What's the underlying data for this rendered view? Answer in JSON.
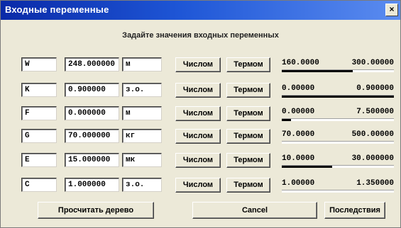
{
  "window": {
    "title": "Входные переменные",
    "close_label": "×"
  },
  "subtitle": "Задайте значения входных переменных",
  "variables": [
    {
      "name": "W",
      "value": "248.000000",
      "unit": "м",
      "num_label": "Числом",
      "term_label": "Термом",
      "min": "160.0000",
      "max": "300.00000",
      "level": 0.63
    },
    {
      "name": "K",
      "value": "0.900000",
      "unit": "з.о.",
      "num_label": "Числом",
      "term_label": "Термом",
      "min": "0.00000",
      "max": "0.900000",
      "level": 1.0
    },
    {
      "name": "F",
      "value": "0.000000",
      "unit": "м",
      "num_label": "Числом",
      "term_label": "Термом",
      "min": "0.00000",
      "max": "7.500000",
      "level": 0.08
    },
    {
      "name": "G",
      "value": "70.000000",
      "unit": "кг",
      "num_label": "Числом",
      "term_label": "Термом",
      "min": "70.0000",
      "max": "500.00000",
      "level": 0.0
    },
    {
      "name": "E",
      "value": "15.000000",
      "unit": "мк",
      "num_label": "Числом",
      "term_label": "Термом",
      "min": "10.0000",
      "max": "30.000000",
      "level": 0.45
    },
    {
      "name": "C",
      "value": "1.000000",
      "unit": "з.о.",
      "num_label": "Числом",
      "term_label": "Термом",
      "min": "1.00000",
      "max": "1.350000",
      "level": 0.0
    }
  ],
  "footer": {
    "calc_label": "Просчитать дерево",
    "cancel_label": "Cancel",
    "conseq_label": "Последствия"
  }
}
